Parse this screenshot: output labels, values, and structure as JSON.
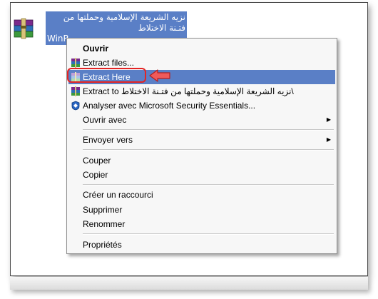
{
  "file": {
    "name": "نزيه الشريعة الإسلامية وحملتها من فتـنة الاختلاط",
    "ext_partial": "WinR",
    "icon": "winrar-archive-icon"
  },
  "menu": {
    "items": [
      {
        "label": "Ouvrir",
        "bold": true
      },
      {
        "label": "Extract files...",
        "icon": "winrar-icon"
      },
      {
        "label": "Extract Here",
        "icon": "winrar-icon",
        "highlighted": true
      },
      {
        "label": "Extract to نزيه الشريعة الإسلامية وحملتها من فتـنة الاختلاط\\",
        "icon": "winrar-icon"
      },
      {
        "label": "Analyser avec Microsoft Security Essentials...",
        "icon": "mse-shield-icon"
      },
      {
        "label": "Ouvrir avec",
        "submenu": true
      },
      {
        "label": "Envoyer vers",
        "submenu": true
      },
      {
        "label": "Couper"
      },
      {
        "label": "Copier"
      },
      {
        "label": "Créer un raccourci"
      },
      {
        "label": "Supprimer"
      },
      {
        "label": "Renommer"
      },
      {
        "label": "Propriétés"
      }
    ],
    "submenu_glyph": "▶"
  },
  "colors": {
    "highlight": "#5a7fc6",
    "callout": "#e32424"
  }
}
